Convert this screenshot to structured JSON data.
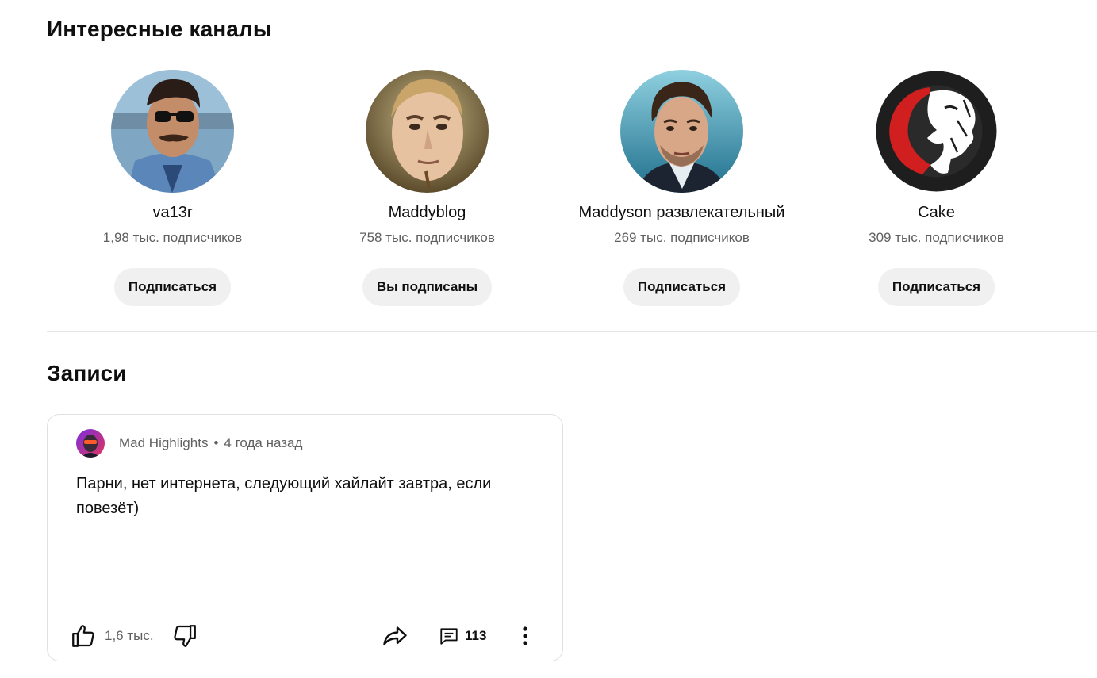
{
  "channels_section": {
    "title": "Интересные каналы",
    "channels": [
      {
        "name": "va13r",
        "subscribers": "1,98 тыс. подписчиков",
        "button": "Подписаться"
      },
      {
        "name": "Maddyblog",
        "subscribers": "758 тыс. подписчиков",
        "button": "Вы подписаны"
      },
      {
        "name": "Maddyson развлекательный",
        "subscribers": "269 тыс. подписчиков",
        "button": "Подписаться"
      },
      {
        "name": "Cake",
        "subscribers": "309 тыс. подписчиков",
        "button": "Подписаться"
      }
    ]
  },
  "posts_section": {
    "title": "Записи",
    "post": {
      "author": "Mad Highlights",
      "separator": "•",
      "time": "4 года назад",
      "text": "Парни, нет интернета, следующий хайлайт завтра, если повезёт)",
      "likes": "1,6 тыс.",
      "comments": "113"
    }
  },
  "icons": {
    "like": "thumb-up-icon",
    "dislike": "thumb-down-icon",
    "share": "share-arrow-icon",
    "comments": "comment-icon",
    "menu": "more-vertical-icon"
  },
  "colors": {
    "button_bg": "#f0f0f0",
    "secondary_text": "#606060",
    "primary_text": "#0f0f0f",
    "cake_logo_red": "#d11f1f"
  }
}
